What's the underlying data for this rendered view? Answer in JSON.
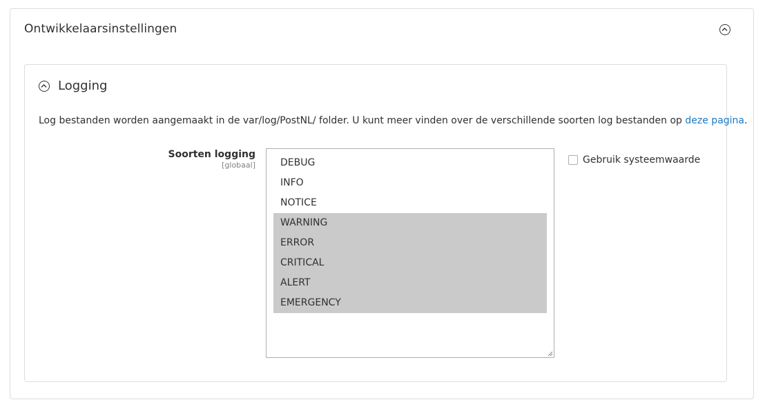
{
  "section": {
    "title": "Ontwikkelaarsinstellingen"
  },
  "group": {
    "title": "Logging",
    "description_prefix": "Log bestanden worden aangemaakt in de var/log/PostNL/ folder. U kunt meer vinden over de verschillende soorten log bestanden op",
    "description_link": "deze pagina",
    "description_suffix": "."
  },
  "field": {
    "label": "Soorten logging",
    "scope": "[globaal]",
    "options": [
      {
        "label": "DEBUG",
        "selected": false
      },
      {
        "label": "INFO",
        "selected": false
      },
      {
        "label": "NOTICE",
        "selected": false
      },
      {
        "label": "WARNING",
        "selected": true
      },
      {
        "label": "ERROR",
        "selected": true
      },
      {
        "label": "CRITICAL",
        "selected": true
      },
      {
        "label": "ALERT",
        "selected": true
      },
      {
        "label": "EMERGENCY",
        "selected": true
      }
    ],
    "use_system_value_label": "Gebruik systeemwaarde",
    "use_system_value_checked": false
  },
  "colors": {
    "link": "#1979c3",
    "selected_option_bg": "#cacaca",
    "border": "#dcdcdc"
  },
  "icons": {
    "section_toggle": "chevron-up-circle-icon",
    "group_toggle": "chevron-up-circle-icon",
    "resize_grip": "resize-grip-icon"
  }
}
